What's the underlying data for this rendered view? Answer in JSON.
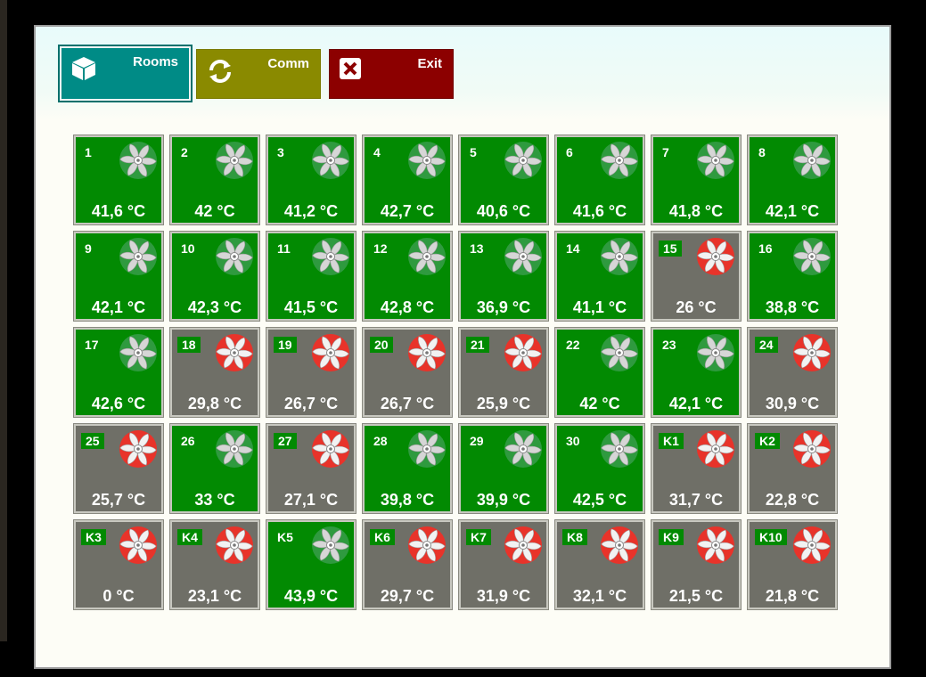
{
  "toolbar": {
    "rooms_label": "Rooms",
    "comm_label": "Comm",
    "exit_label": "Exit"
  },
  "colors": {
    "active_tile": "#028a02",
    "inactive_tile": "#6f6f67",
    "fan_on": "#d9d9d9",
    "fan_off": "#e8332a",
    "rooms_button": "#008b86",
    "comm_button": "#8a8a00",
    "exit_button": "#8c0000"
  },
  "rooms": [
    {
      "id": "1",
      "temp": "41,6 °C",
      "status": "on"
    },
    {
      "id": "2",
      "temp": "42 °C",
      "status": "on"
    },
    {
      "id": "3",
      "temp": "41,2 °C",
      "status": "on"
    },
    {
      "id": "4",
      "temp": "42,7 °C",
      "status": "on"
    },
    {
      "id": "5",
      "temp": "40,6 °C",
      "status": "on"
    },
    {
      "id": "6",
      "temp": "41,6 °C",
      "status": "on"
    },
    {
      "id": "7",
      "temp": "41,8 °C",
      "status": "on"
    },
    {
      "id": "8",
      "temp": "42,1 °C",
      "status": "on"
    },
    {
      "id": "9",
      "temp": "42,1 °C",
      "status": "on"
    },
    {
      "id": "10",
      "temp": "42,3 °C",
      "status": "on"
    },
    {
      "id": "11",
      "temp": "41,5 °C",
      "status": "on"
    },
    {
      "id": "12",
      "temp": "42,8 °C",
      "status": "on"
    },
    {
      "id": "13",
      "temp": "36,9 °C",
      "status": "on"
    },
    {
      "id": "14",
      "temp": "41,1 °C",
      "status": "on"
    },
    {
      "id": "15",
      "temp": "26 °C",
      "status": "off"
    },
    {
      "id": "16",
      "temp": "38,8 °C",
      "status": "on"
    },
    {
      "id": "17",
      "temp": "42,6 °C",
      "status": "on"
    },
    {
      "id": "18",
      "temp": "29,8 °C",
      "status": "off"
    },
    {
      "id": "19",
      "temp": "26,7 °C",
      "status": "off"
    },
    {
      "id": "20",
      "temp": "26,7 °C",
      "status": "off"
    },
    {
      "id": "21",
      "temp": "25,9 °C",
      "status": "off"
    },
    {
      "id": "22",
      "temp": "42 °C",
      "status": "on"
    },
    {
      "id": "23",
      "temp": "42,1 °C",
      "status": "on"
    },
    {
      "id": "24",
      "temp": "30,9 °C",
      "status": "off"
    },
    {
      "id": "25",
      "temp": "25,7 °C",
      "status": "off"
    },
    {
      "id": "26",
      "temp": "33 °C",
      "status": "on"
    },
    {
      "id": "27",
      "temp": "27,1 °C",
      "status": "off"
    },
    {
      "id": "28",
      "temp": "39,8 °C",
      "status": "on"
    },
    {
      "id": "29",
      "temp": "39,9 °C",
      "status": "on"
    },
    {
      "id": "30",
      "temp": "42,5 °C",
      "status": "on"
    },
    {
      "id": "K1",
      "temp": "31,7 °C",
      "status": "off"
    },
    {
      "id": "K2",
      "temp": "22,8 °C",
      "status": "off"
    },
    {
      "id": "K3",
      "temp": "0 °C",
      "status": "off"
    },
    {
      "id": "K4",
      "temp": "23,1 °C",
      "status": "off"
    },
    {
      "id": "K5",
      "temp": "43,9 °C",
      "status": "on"
    },
    {
      "id": "K6",
      "temp": "29,7 °C",
      "status": "off"
    },
    {
      "id": "K7",
      "temp": "31,9 °C",
      "status": "off"
    },
    {
      "id": "K8",
      "temp": "32,1 °C",
      "status": "off"
    },
    {
      "id": "K9",
      "temp": "21,5 °C",
      "status": "off"
    },
    {
      "id": "K10",
      "temp": "21,8 °C",
      "status": "off"
    }
  ]
}
